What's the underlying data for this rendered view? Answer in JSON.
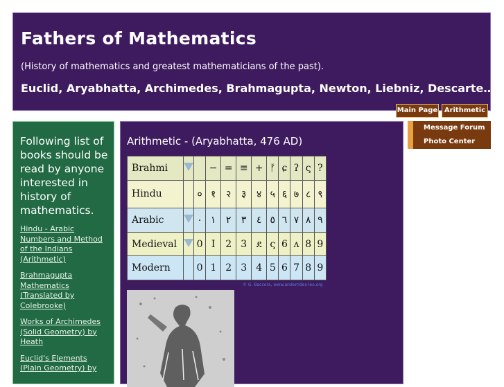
{
  "header": {
    "title": "Fathers of Mathematics",
    "subtitle": "(History of mathematics and greatest mathematicians of the past).",
    "names": "Euclid, Aryabhatta, Archimedes, Brahmagupta, Newton, Liebniz, Descarte……."
  },
  "topnav": {
    "main_page": "Main Page",
    "arithmetic": "Arithmetic"
  },
  "sidebar": {
    "intro": "Following list of books should be read by anyone interested in history of mathematics.",
    "links": [
      "Hindu - Arabic Numbers and Method of the Indians (Arithmetic)",
      "Brahmagupta Mathematics (Translated by Colebrooke)",
      "Works of Archimedes (Solid Geometry) by Heath",
      "Euclid's Elements (Plain Geometry) by"
    ]
  },
  "main": {
    "heading": "Arithmetic - (Aryabhatta, 476 AD)",
    "table": {
      "rows": [
        {
          "label": "Brahmi",
          "digits": [
            "",
            "−",
            "=",
            "≡",
            "+",
            "ᚠ",
            "ɕ",
            "ʔ",
            "ς",
            "?"
          ],
          "bg": "#e4e9c4",
          "arrow": true
        },
        {
          "label": "Hindu",
          "digits": [
            "०",
            "१",
            "२",
            "३",
            "४",
            "५",
            "६",
            "७",
            "८",
            "९"
          ],
          "bg": "#f3f3d0",
          "arrow": false
        },
        {
          "label": "Arabic",
          "digits": [
            "٠",
            "١",
            "٢",
            "٣",
            "٤",
            "٥",
            "٦",
            "٧",
            "٨",
            "٩"
          ],
          "bg": "#cfe6f0",
          "arrow": true
        },
        {
          "label": "Medieval",
          "digits": [
            "0",
            "I",
            "2",
            "3",
            "ደ",
            "ς",
            "6",
            "ʌ",
            "8",
            "9"
          ],
          "bg": "#eef0c6",
          "arrow": true
        },
        {
          "label": "Modern",
          "digits": [
            "0",
            "1",
            "2",
            "3",
            "4",
            "5",
            "6",
            "7",
            "8",
            "9"
          ],
          "bg": "#cde6f5",
          "arrow": false
        }
      ],
      "credit": "© G. Baccera, www.anderrides-leo.org"
    }
  },
  "rightnav": {
    "items": [
      "Message Forum",
      "Photo Center"
    ]
  }
}
